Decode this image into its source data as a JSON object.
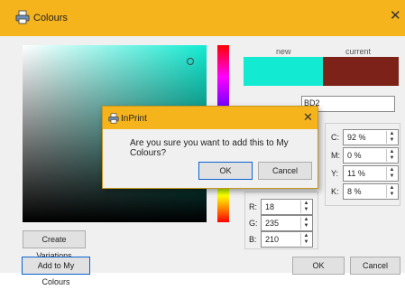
{
  "window": {
    "title": "Colours",
    "close_symbol": "✕"
  },
  "preview": {
    "new_label": "new",
    "current_label": "current",
    "new_color": "#12ebd2",
    "current_color": "#7c2218"
  },
  "hex": {
    "value": "BD2"
  },
  "cmyk": [
    {
      "label": "C:",
      "value": "92 %"
    },
    {
      "label": "M:",
      "value": "0 %"
    },
    {
      "label": "Y:",
      "value": "11 %"
    },
    {
      "label": "K:",
      "value": "8 %"
    }
  ],
  "rgb": [
    {
      "label": "R:",
      "value": "18"
    },
    {
      "label": "G:",
      "value": "235"
    },
    {
      "label": "B:",
      "value": "210"
    }
  ],
  "buttons": {
    "create_variations": "Create Variations",
    "add_to_my_colours": "Add to My Colours",
    "ok": "OK",
    "cancel": "Cancel"
  },
  "dialog": {
    "title": "InPrint",
    "message": "Are you sure you want to add this to My Colours?",
    "ok": "OK",
    "cancel": "Cancel",
    "close_symbol": "✕"
  },
  "icons": {
    "app": "printer-icon",
    "spin_up": "▲",
    "spin_down": "▼"
  }
}
